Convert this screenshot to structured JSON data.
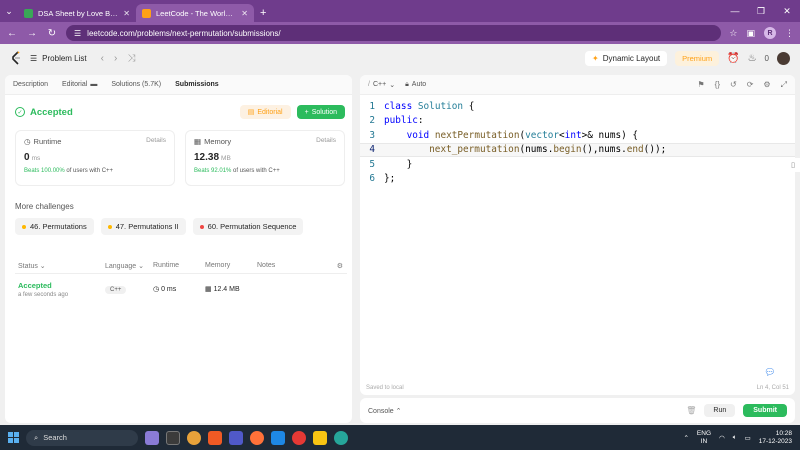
{
  "browser": {
    "tabs": [
      {
        "title": "DSA Sheet by Love Babbar - Ge",
        "active": false
      },
      {
        "title": "LeetCode - The World's Leadin",
        "active": true
      }
    ],
    "url": "leetcode.com/problems/next-permutation/submissions/",
    "profile_letter": "R"
  },
  "header": {
    "problem_list": "Problem List",
    "dynamic_layout": "Dynamic Layout",
    "premium": "Premium",
    "streak": "0"
  },
  "subtabs": [
    "Description",
    "Editorial",
    "Solutions (5.7K)",
    "Submissions"
  ],
  "result": {
    "status": "Accepted",
    "editorial_btn": "Editorial",
    "solution_btn": "Solution"
  },
  "runtime": {
    "label": "Runtime",
    "details": "Details",
    "value": "0",
    "unit": "ms",
    "beats_label": "Beats",
    "beats_pct": "100.00%",
    "beats_suffix": "of users with C++"
  },
  "memory": {
    "label": "Memory",
    "details": "Details",
    "value": "12.38",
    "unit": "MB",
    "beats_label": "Beats",
    "beats_pct": "92.01%",
    "beats_suffix": "of users with C++"
  },
  "challenges": {
    "heading": "More challenges",
    "items": [
      {
        "label": "46. Permutations",
        "color": "#ffb800"
      },
      {
        "label": "47. Permutations II",
        "color": "#ffb800"
      },
      {
        "label": "60. Permutation Sequence",
        "color": "#ef4743"
      }
    ]
  },
  "table": {
    "headers": [
      "Status",
      "Language",
      "Runtime",
      "Memory",
      "Notes"
    ],
    "rows": [
      {
        "status": "Accepted",
        "time_ago": "a few seconds ago",
        "language": "C++",
        "runtime": "0 ms",
        "memory": "12.4 MB"
      }
    ]
  },
  "editor": {
    "language": "C++",
    "auto": "Auto",
    "line_numbers": [
      "1",
      "2",
      "3",
      "4",
      "5",
      "6"
    ],
    "saved": "Saved to local",
    "cursor": "Ln 4, Col 51"
  },
  "console": {
    "label": "Console",
    "run": "Run",
    "submit": "Submit"
  },
  "taskbar": {
    "search": "Search",
    "lang_line1": "ENG",
    "lang_line2": "IN",
    "time": "10:28",
    "date": "17-12-2023"
  }
}
